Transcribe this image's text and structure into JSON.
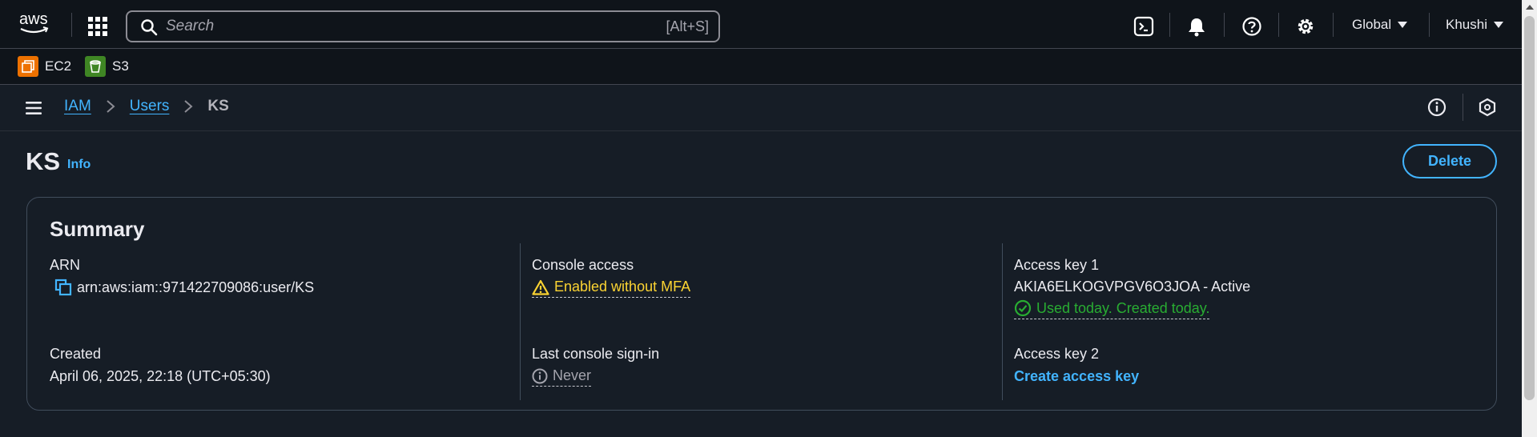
{
  "topbar": {
    "logo_text": "aws",
    "search": {
      "placeholder": "Search",
      "shortcut": "[Alt+S]"
    },
    "region": "Global",
    "user": "Khushi",
    "icons": [
      "cloudshell-icon",
      "bell-icon",
      "help-icon",
      "gear-icon"
    ]
  },
  "favorites": [
    {
      "label": "EC2",
      "color": "#ed7100"
    },
    {
      "label": "S3",
      "color": "#3f8624"
    }
  ],
  "breadcrumb": {
    "items": [
      {
        "label": "IAM"
      },
      {
        "label": "Users"
      },
      {
        "label": "KS"
      }
    ]
  },
  "header": {
    "title": "KS",
    "info_label": "Info",
    "delete_label": "Delete"
  },
  "summary": {
    "title": "Summary",
    "arn": {
      "label": "ARN",
      "value": "arn:aws:iam::971422709086:user/KS"
    },
    "created": {
      "label": "Created",
      "value": "April 06, 2025, 22:18 (UTC+05:30)"
    },
    "console_access": {
      "label": "Console access",
      "value": "Enabled without MFA"
    },
    "last_signin": {
      "label": "Last console sign-in",
      "value": "Never"
    },
    "access_key_1": {
      "label": "Access key 1",
      "value": "AKIA6ELKOGVPGV6O3JOA - Active",
      "status": "Used today. Created today."
    },
    "access_key_2": {
      "label": "Access key 2",
      "action": "Create access key"
    }
  },
  "colors": {
    "link": "#42b4ff",
    "warning": "#fbd332",
    "success": "#29ad32",
    "background": "#161d26",
    "topbar": "#0f141a"
  }
}
